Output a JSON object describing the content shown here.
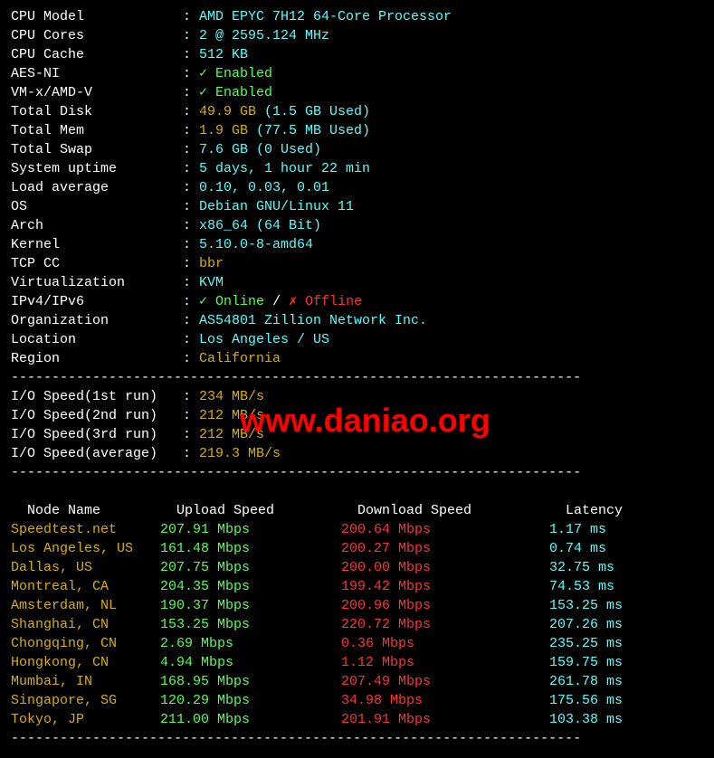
{
  "system": [
    {
      "label": "CPU Model",
      "value": "AMD EPYC 7H12 64-Core Processor",
      "color": "cyan"
    },
    {
      "label": "CPU Cores",
      "value": "2 @ 2595.124 MHz",
      "color": "cyan"
    },
    {
      "label": "CPU Cache",
      "value": "512 KB",
      "color": "cyan"
    },
    {
      "label": "AES-NI",
      "value": "✓ Enabled",
      "color": "green"
    },
    {
      "label": "VM-x/AMD-V",
      "value": "✓ Enabled",
      "color": "green"
    },
    {
      "label": "Total Disk",
      "value": "49.9 GB",
      "extra": "(1.5 GB Used)",
      "color": "yellow"
    },
    {
      "label": "Total Mem",
      "value": "1.9 GB",
      "extra": "(77.5 MB Used)",
      "color": "yellow"
    },
    {
      "label": "Total Swap",
      "value": "7.6 GB",
      "extra": "(0 Used)",
      "color": "cyan"
    },
    {
      "label": "System uptime",
      "value": "5 days, 1 hour 22 min",
      "color": "cyan"
    },
    {
      "label": "Load average",
      "value": "0.10, 0.03, 0.01",
      "color": "cyan"
    },
    {
      "label": "OS",
      "value": "Debian GNU/Linux 11",
      "color": "cyan"
    },
    {
      "label": "Arch",
      "value": "x86_64 (64 Bit)",
      "color": "cyan"
    },
    {
      "label": "Kernel",
      "value": "5.10.0-8-amd64",
      "color": "cyan"
    },
    {
      "label": "TCP CC",
      "value": "bbr",
      "color": "yellow"
    },
    {
      "label": "Virtualization",
      "value": "KVM",
      "color": "cyan"
    },
    {
      "label": "IPv4/IPv6",
      "special": "ipv"
    },
    {
      "label": "Organization",
      "value": "AS54801 Zillion Network Inc.",
      "color": "cyan"
    },
    {
      "label": "Location",
      "value": "Los Angeles / US",
      "color": "cyan"
    },
    {
      "label": "Region",
      "value": "California",
      "color": "yellow"
    }
  ],
  "ipv": {
    "online": "✓ Online",
    "sep": " / ",
    "offline": "✗ Offline"
  },
  "io": [
    {
      "label": "I/O Speed(1st run) ",
      "value": "234 MB/s"
    },
    {
      "label": "I/O Speed(2nd run) ",
      "value": "212 MB/s"
    },
    {
      "label": "I/O Speed(3rd run) ",
      "value": "212 MB/s"
    },
    {
      "label": "I/O Speed(average) ",
      "value": "219.3 MB/s"
    }
  ],
  "speed": {
    "headers": {
      "node": "Node Name",
      "up": "Upload Speed",
      "down": "Download Speed",
      "lat": "Latency"
    },
    "rows": [
      {
        "node": "Speedtest.net",
        "up": "207.91 Mbps",
        "down": "200.64 Mbps",
        "lat": "1.17 ms"
      },
      {
        "node": "Los Angeles, US",
        "up": "161.48 Mbps",
        "down": "200.27 Mbps",
        "lat": "0.74 ms"
      },
      {
        "node": "Dallas, US",
        "up": "207.75 Mbps",
        "down": "200.00 Mbps",
        "lat": "32.75 ms"
      },
      {
        "node": "Montreal, CA",
        "up": "204.35 Mbps",
        "down": "199.42 Mbps",
        "lat": "74.53 ms"
      },
      {
        "node": "Amsterdam, NL",
        "up": "190.37 Mbps",
        "down": "200.96 Mbps",
        "lat": "153.25 ms"
      },
      {
        "node": "Shanghai, CN",
        "up": "153.25 Mbps",
        "down": "220.72 Mbps",
        "lat": "207.26 ms"
      },
      {
        "node": "Chongqing, CN",
        "up": "2.69 Mbps",
        "down": "0.36 Mbps",
        "lat": "235.25 ms"
      },
      {
        "node": "Hongkong, CN",
        "up": "4.94 Mbps",
        "down": "1.12 Mbps",
        "lat": "159.75 ms"
      },
      {
        "node": "Mumbai, IN",
        "up": "168.95 Mbps",
        "down": "207.49 Mbps",
        "lat": "261.78 ms"
      },
      {
        "node": "Singapore, SG",
        "up": "120.29 Mbps",
        "down": "34.98 Mbps",
        "lat": "175.56 ms"
      },
      {
        "node": "Tokyo, JP",
        "up": "211.00 Mbps",
        "down": "201.91 Mbps",
        "lat": "103.38 ms"
      }
    ]
  },
  "divider": "----------------------------------------------------------------------",
  "watermark": "www.daniao.org"
}
